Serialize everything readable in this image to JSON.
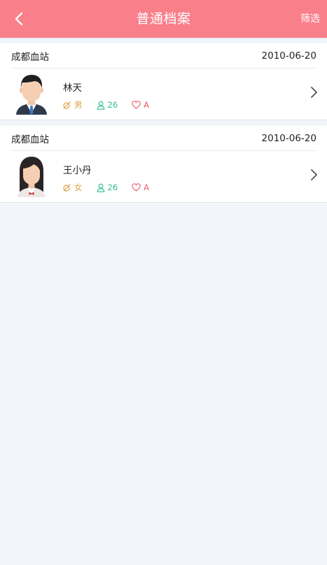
{
  "header": {
    "title": "普通档案",
    "filter_label": "筛选",
    "bg_color": "#f97f8b"
  },
  "records": [
    {
      "station": "成都血站",
      "date": "2010-06-20",
      "name": "林天",
      "gender": "男",
      "age": "26",
      "blood_type": "A",
      "avatar": "male-avatar"
    },
    {
      "station": "成都血站",
      "date": "2010-06-20",
      "name": "王小丹",
      "gender": "女",
      "age": "26",
      "blood_type": "A",
      "avatar": "female-avatar"
    }
  ]
}
